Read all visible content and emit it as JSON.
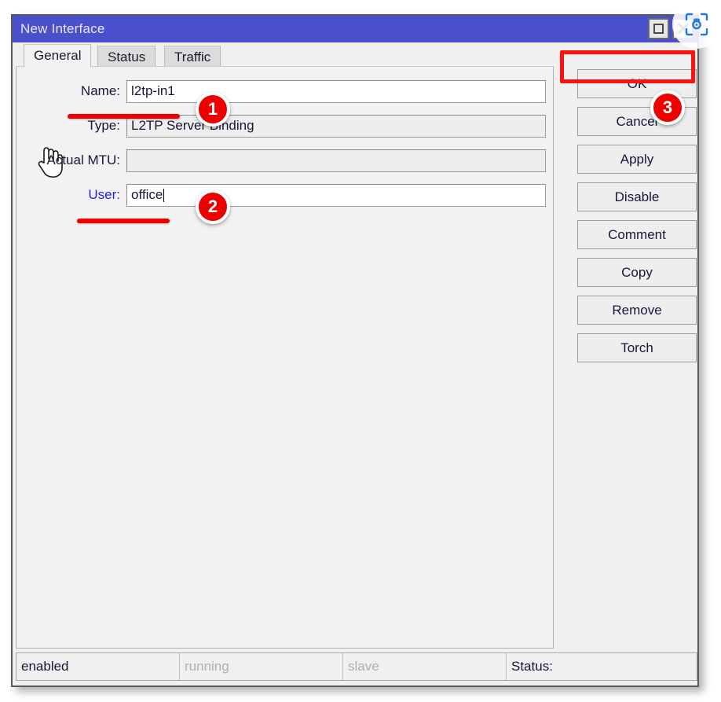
{
  "window": {
    "title": "New Interface",
    "controls": {
      "maximize_label": "maximize",
      "close_label": "close"
    }
  },
  "tabs": [
    {
      "label": "General",
      "active": true
    },
    {
      "label": "Status",
      "active": false
    },
    {
      "label": "Traffic",
      "active": false
    }
  ],
  "form": {
    "fields": [
      {
        "label": "Name:",
        "value": "l2tp-in1",
        "readonly": false,
        "accent": false,
        "caret": false
      },
      {
        "label": "Type:",
        "value": "L2TP Server Binding",
        "readonly": true,
        "accent": false,
        "caret": false
      },
      {
        "label": "Actual MTU:",
        "value": "",
        "readonly": true,
        "accent": false,
        "caret": false
      },
      {
        "label": "User:",
        "value": "office",
        "readonly": false,
        "accent": true,
        "caret": true
      }
    ]
  },
  "buttons": [
    {
      "label": "OK",
      "highlighted": true
    },
    {
      "label": "Cancel",
      "highlighted": false
    },
    {
      "label": "Apply",
      "highlighted": false
    },
    {
      "label": "Disable",
      "highlighted": false
    },
    {
      "label": "Comment",
      "highlighted": false
    },
    {
      "label": "Copy",
      "highlighted": false
    },
    {
      "label": "Remove",
      "highlighted": false
    },
    {
      "label": "Torch",
      "highlighted": false
    }
  ],
  "statusbar": {
    "cells": [
      {
        "text": "enabled",
        "active": true
      },
      {
        "text": "running",
        "active": false
      },
      {
        "text": "slave",
        "active": false
      },
      {
        "text": "Status:",
        "active": true
      }
    ]
  },
  "annotations": {
    "badges": [
      {
        "number": "1"
      },
      {
        "number": "2"
      },
      {
        "number": "3"
      }
    ],
    "accent_color": "#ee0000"
  },
  "overlay": {
    "icon": "screenshot-capture-icon"
  }
}
